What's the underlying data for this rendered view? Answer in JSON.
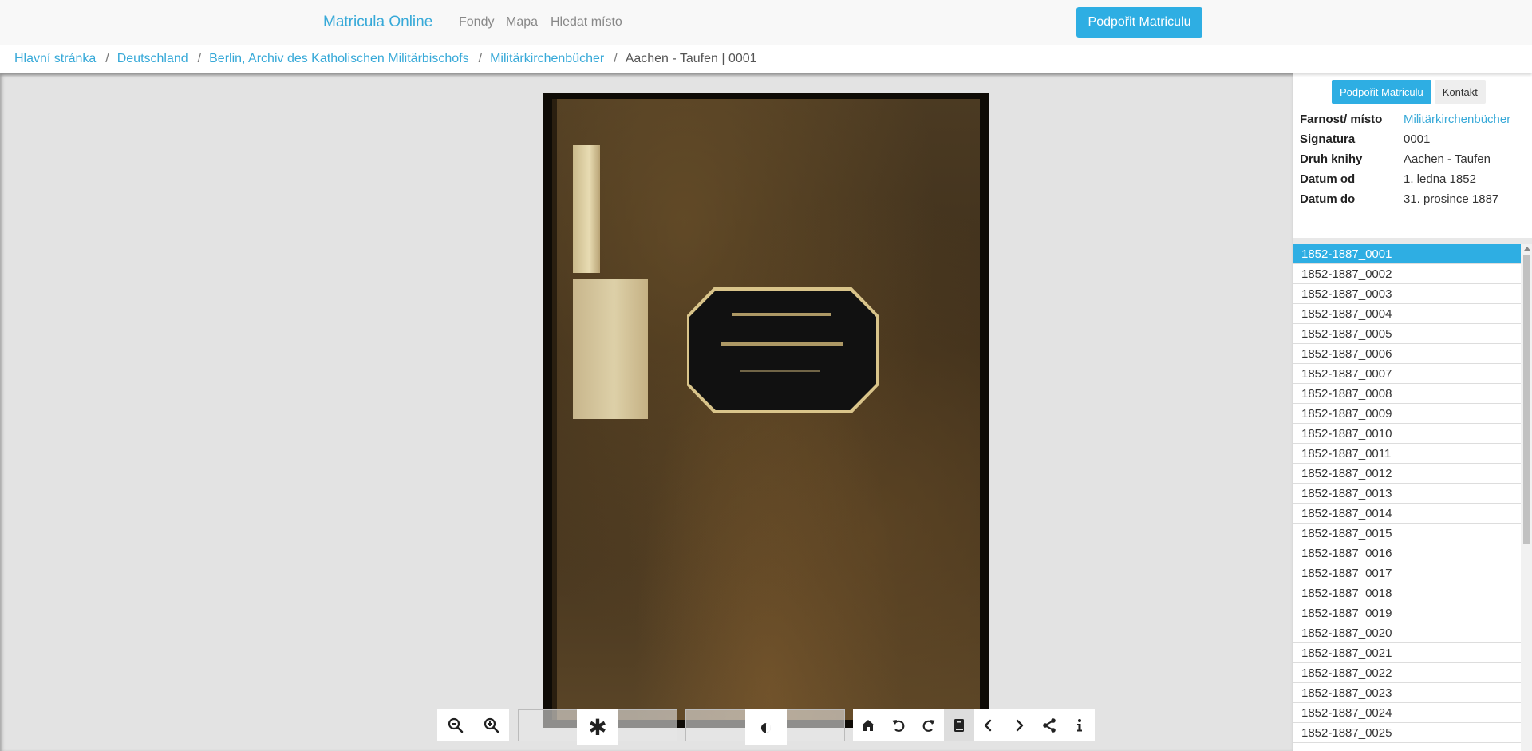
{
  "navbar": {
    "brand": "Matricula Online",
    "links": {
      "fondy": "Fondy",
      "mapa": "Mapa",
      "hledat": "Hledat místo"
    },
    "support_button": "Podpořit Matriculu"
  },
  "breadcrumb": {
    "items": [
      "Hlavní stránka",
      "Deutschland",
      "Berlin, Archiv des Katholischen Militärbischofs",
      "Militärkirchenbücher"
    ],
    "current": "Aachen - Taufen | 0001",
    "separator": "/"
  },
  "toolbar": {
    "icons": {
      "zoom_out": "zoom-out-icon",
      "zoom_in": "zoom-in-icon",
      "brightness": "asterisk-icon",
      "contrast": "contrast-icon",
      "home": "home-icon",
      "rotate_left": "rotate-left-icon",
      "rotate_right": "rotate-right-icon",
      "book": "book-icon",
      "prev": "chevron-left-icon",
      "next": "chevron-right-icon",
      "share": "share-icon",
      "info": "info-icon"
    },
    "brightness_glyph": "✱",
    "contrast_glyph": "◐"
  },
  "side": {
    "tabs": {
      "support": "Podpořit Matriculu",
      "contact": "Kontakt"
    },
    "info": {
      "parish_label": "Farnost/ místo",
      "parish_value": "Militärkirchenbücher",
      "signature_label": "Signatura",
      "signature_value": "0001",
      "type_label": "Druh knihy",
      "type_value": "Aachen - Taufen",
      "from_label": "Datum od",
      "from_value": "1. ledna 1852",
      "to_label": "Datum do",
      "to_value": "31. prosince 1887"
    },
    "pages": [
      "1852-1887_0001",
      "1852-1887_0002",
      "1852-1887_0003",
      "1852-1887_0004",
      "1852-1887_0005",
      "1852-1887_0006",
      "1852-1887_0007",
      "1852-1887_0008",
      "1852-1887_0009",
      "1852-1887_0010",
      "1852-1887_0011",
      "1852-1887_0012",
      "1852-1887_0013",
      "1852-1887_0014",
      "1852-1887_0015",
      "1852-1887_0016",
      "1852-1887_0017",
      "1852-1887_0018",
      "1852-1887_0019",
      "1852-1887_0020",
      "1852-1887_0021",
      "1852-1887_0022",
      "1852-1887_0023",
      "1852-1887_0024",
      "1852-1887_0025"
    ],
    "selected_index": 0
  },
  "colors": {
    "accent": "#2eaee3",
    "link": "#37a9d8"
  }
}
